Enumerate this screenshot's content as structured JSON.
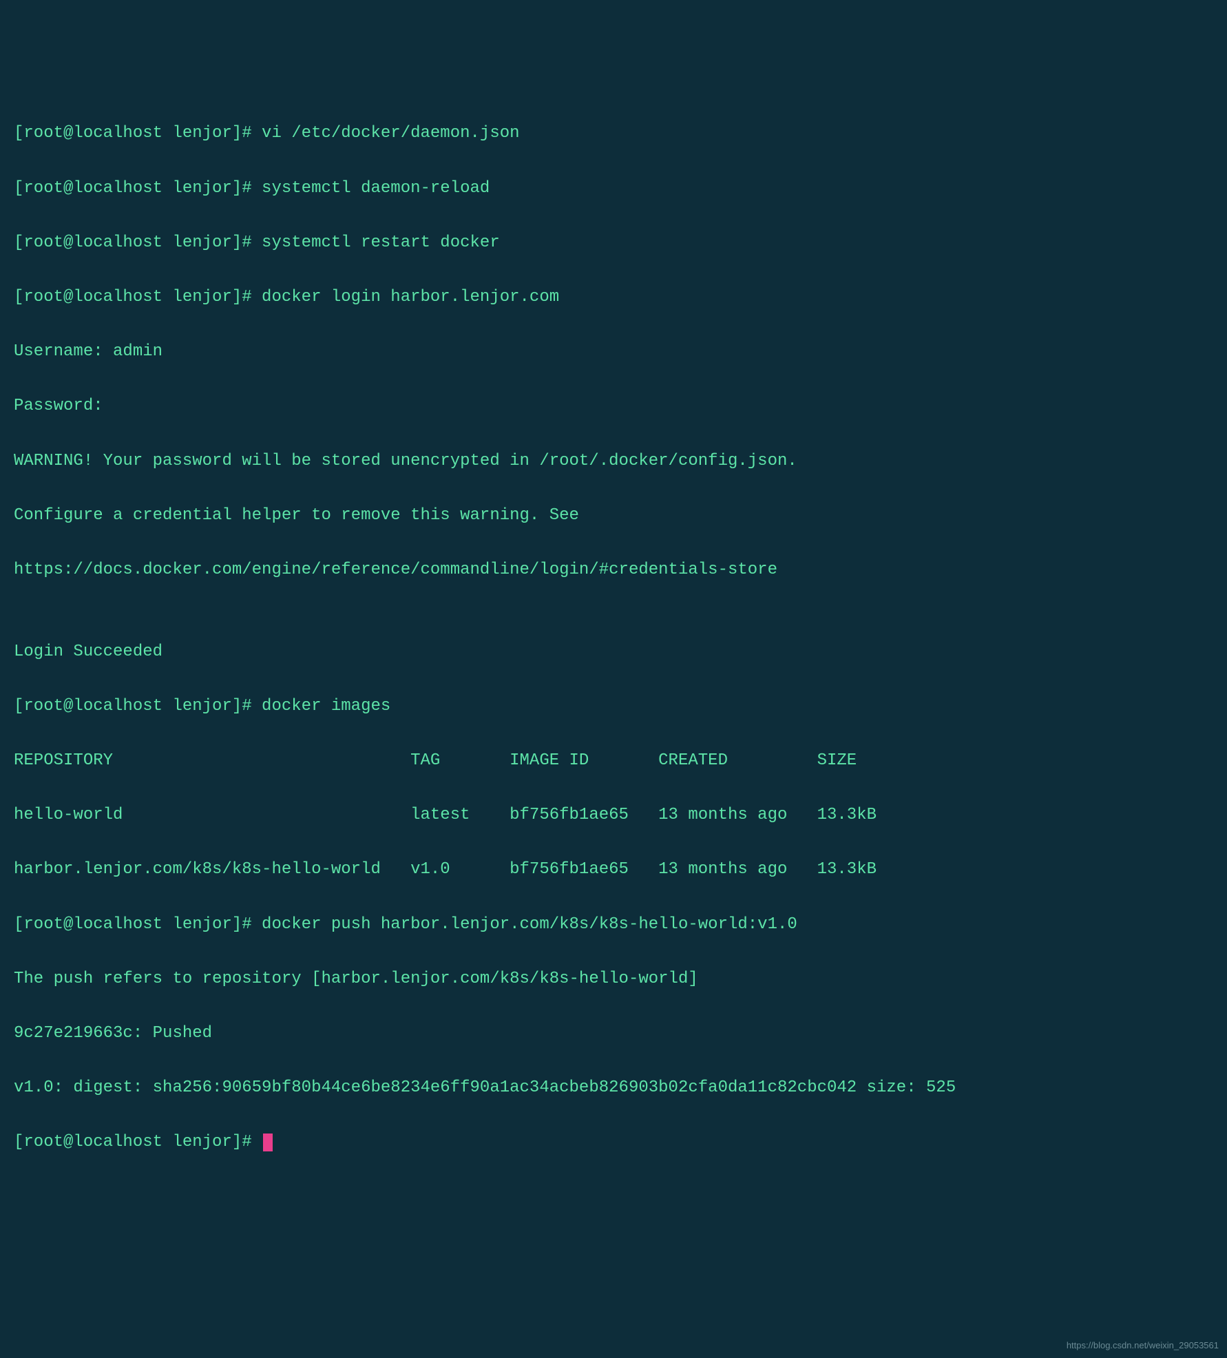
{
  "prompt": "[root@localhost lenjor]# ",
  "lines": {
    "l1": "[root@localhost lenjor]# vi /etc/docker/daemon.json",
    "l2": "[root@localhost lenjor]# systemctl daemon-reload",
    "l3": "[root@localhost lenjor]# systemctl restart docker",
    "l4": "[root@localhost lenjor]# docker login harbor.lenjor.com",
    "l5": "Username: admin",
    "l6": "Password:",
    "l7": "WARNING! Your password will be stored unencrypted in /root/.docker/config.json.",
    "l8": "Configure a credential helper to remove this warning. See",
    "l9": "https://docs.docker.com/engine/reference/commandline/login/#credentials-store",
    "l10": "",
    "l11": "Login Succeeded",
    "l12": "[root@localhost lenjor]# docker images",
    "l13": "REPOSITORY                              TAG       IMAGE ID       CREATED         SIZE",
    "l14": "hello-world                             latest    bf756fb1ae65   13 months ago   13.3kB",
    "l15": "harbor.lenjor.com/k8s/k8s-hello-world   v1.0      bf756fb1ae65   13 months ago   13.3kB",
    "l16": "[root@localhost lenjor]# docker push harbor.lenjor.com/k8s/k8s-hello-world:v1.0",
    "l17": "The push refers to repository [harbor.lenjor.com/k8s/k8s-hello-world]",
    "l18": "9c27e219663c: Pushed",
    "l19": "v1.0: digest: sha256:90659bf80b44ce6be8234e6ff90a1ac34acbeb826903b02cfa0da11c82cbc042 size: 525",
    "l20": "[root@localhost lenjor]# "
  },
  "watermark": "https://blog.csdn.net/weixin_29053561"
}
